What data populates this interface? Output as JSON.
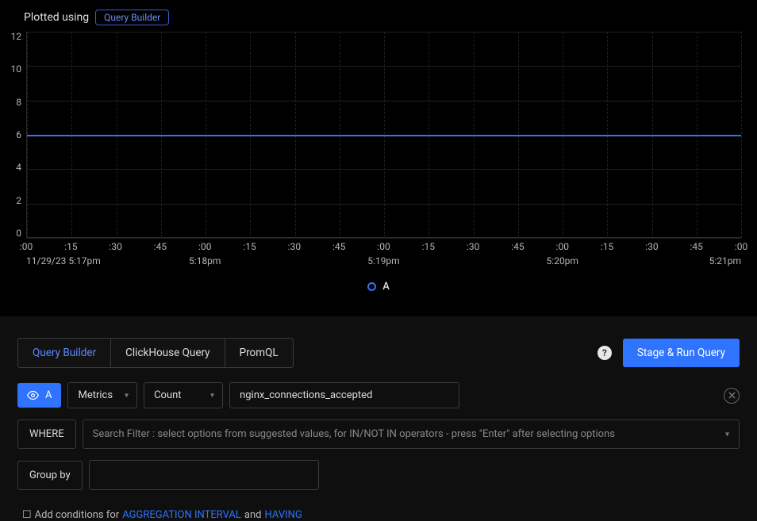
{
  "header": {
    "plotted_using": "Plotted using",
    "mode_tag": "Query Builder"
  },
  "chart_data": {
    "type": "line",
    "title": "",
    "xlabel": "",
    "ylabel": "",
    "ylim": [
      0,
      12
    ],
    "y_ticks": [
      12,
      10,
      8,
      6,
      4,
      2,
      0
    ],
    "x_ticks_minor": [
      ":00",
      ":15",
      ":30",
      ":45",
      ":00",
      ":15",
      ":30",
      ":45",
      ":00",
      ":15",
      ":30",
      ":45",
      ":00",
      ":15",
      ":30",
      ":45",
      ":00"
    ],
    "x_ticks_major": [
      {
        "pos": 0,
        "label": "11/29/23 5:17pm",
        "align": "left"
      },
      {
        "pos": 4,
        "label": "5:18pm",
        "align": "center"
      },
      {
        "pos": 8,
        "label": "5:19pm",
        "align": "center"
      },
      {
        "pos": 12,
        "label": "5:20pm",
        "align": "center"
      },
      {
        "pos": 16,
        "label": "5:21pm",
        "align": "right"
      }
    ],
    "series": [
      {
        "name": "A",
        "color": "#3a6ff5",
        "constant_value": 6
      }
    ],
    "legend": [
      {
        "name": "A"
      }
    ]
  },
  "tabs": {
    "items": [
      "Query Builder",
      "ClickHouse Query",
      "PromQL"
    ],
    "active_index": 0,
    "run_label": "Stage & Run Query"
  },
  "queryA": {
    "visibility_label": "A",
    "data_source": "Metrics",
    "aggregation": "Count",
    "metric_name": "nginx_connections_accepted"
  },
  "where": {
    "label": "WHERE",
    "placeholder": "Search Filter : select options from suggested values, for IN/NOT IN operators - press \"Enter\" after selecting options"
  },
  "groupby": {
    "label": "Group by"
  },
  "footnote": {
    "prefix": "Add conditions for",
    "link1": "AGGREGATION INTERVAL",
    "mid": "and",
    "link2": "HAVING"
  }
}
